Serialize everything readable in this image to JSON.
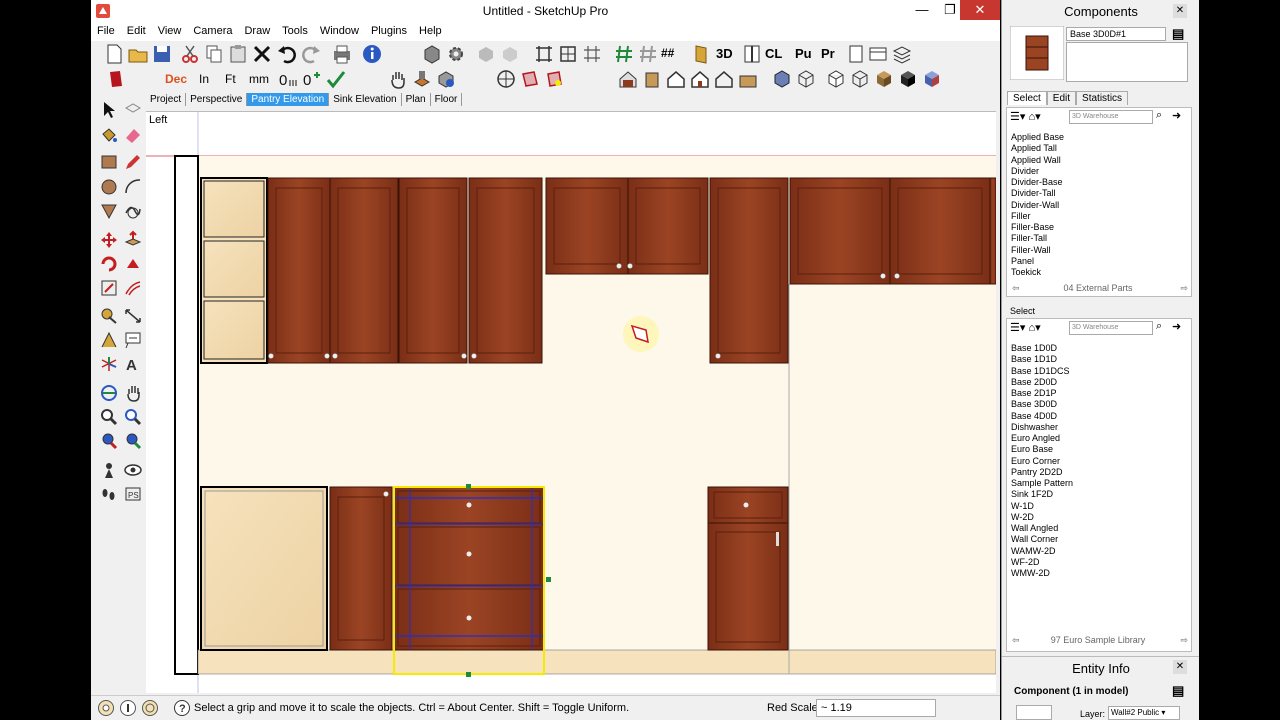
{
  "window": {
    "title": "Untitled - SketchUp Pro",
    "minimize": "—",
    "maximize": "❐",
    "close": "✕"
  },
  "menu": [
    "File",
    "Edit",
    "View",
    "Camera",
    "Draw",
    "Tools",
    "Window",
    "Plugins",
    "Help"
  ],
  "toolbar": {
    "text_buttons": {
      "mm_3d": "3D",
      "cl": "CL",
      "pu": "Pu",
      "pr": "Pr"
    },
    "units": {
      "dec": "Dec",
      "in": "In",
      "ft": "Ft",
      "mm": "mm"
    }
  },
  "scenes": [
    "Project",
    "Perspective",
    "Pantry Elevation",
    "Sink Elevation",
    "Plan",
    "Floor"
  ],
  "active_scene": "Pantry Elevation",
  "viewport": {
    "view_label": "Left"
  },
  "status": {
    "hint": "Select a grip and move it to scale the objects. Ctrl = About Center. Shift = Toggle Uniform.",
    "measure_label": "Red Scale",
    "measure_value": "~ 1.19"
  },
  "components_panel": {
    "title": "Components",
    "component_name": "Base 3D0D#1",
    "tabs": [
      "Select",
      "Edit",
      "Statistics"
    ],
    "search_placeholder": "3D Warehouse",
    "list1": [
      "Applied Base",
      "Applied Tall",
      "Applied Wall",
      "Divider",
      "Divider-Base",
      "Divider-Tall",
      "Divider-Wall",
      "Filler",
      "Filler-Base",
      "Filler-Tall",
      "Filler-Wall",
      "Panel",
      "Toekick"
    ],
    "list1_folder": "04 External Parts",
    "select_label": "Select",
    "list2": [
      "Base 1D0D",
      "Base 1D1D",
      "Base 1D1DCS",
      "Base 2D0D",
      "Base 2D1P",
      "Base 3D0D",
      "Base 4D0D",
      "Dishwasher",
      "Euro Angled",
      "Euro Base",
      "Euro Corner",
      "Pantry 2D2D",
      "Sample Pattern",
      "Sink 1F2D",
      "W-1D",
      "W-2D",
      "Wall Angled",
      "Wall Corner",
      "WAMW-2D",
      "WF-2D",
      "WMW-2D"
    ],
    "list2_folder": "97 Euro Sample Library"
  },
  "entity_info": {
    "title": "Entity Info",
    "summary": "Component (1 in model)",
    "layer_label": "Layer:",
    "layer_value": "Wall#2 Public"
  },
  "colors": {
    "cabinet": "#8b3a1e",
    "cabinet_light": "#f2d9b0",
    "selection": "#f5ea00",
    "scene_active": "#3399e8"
  }
}
